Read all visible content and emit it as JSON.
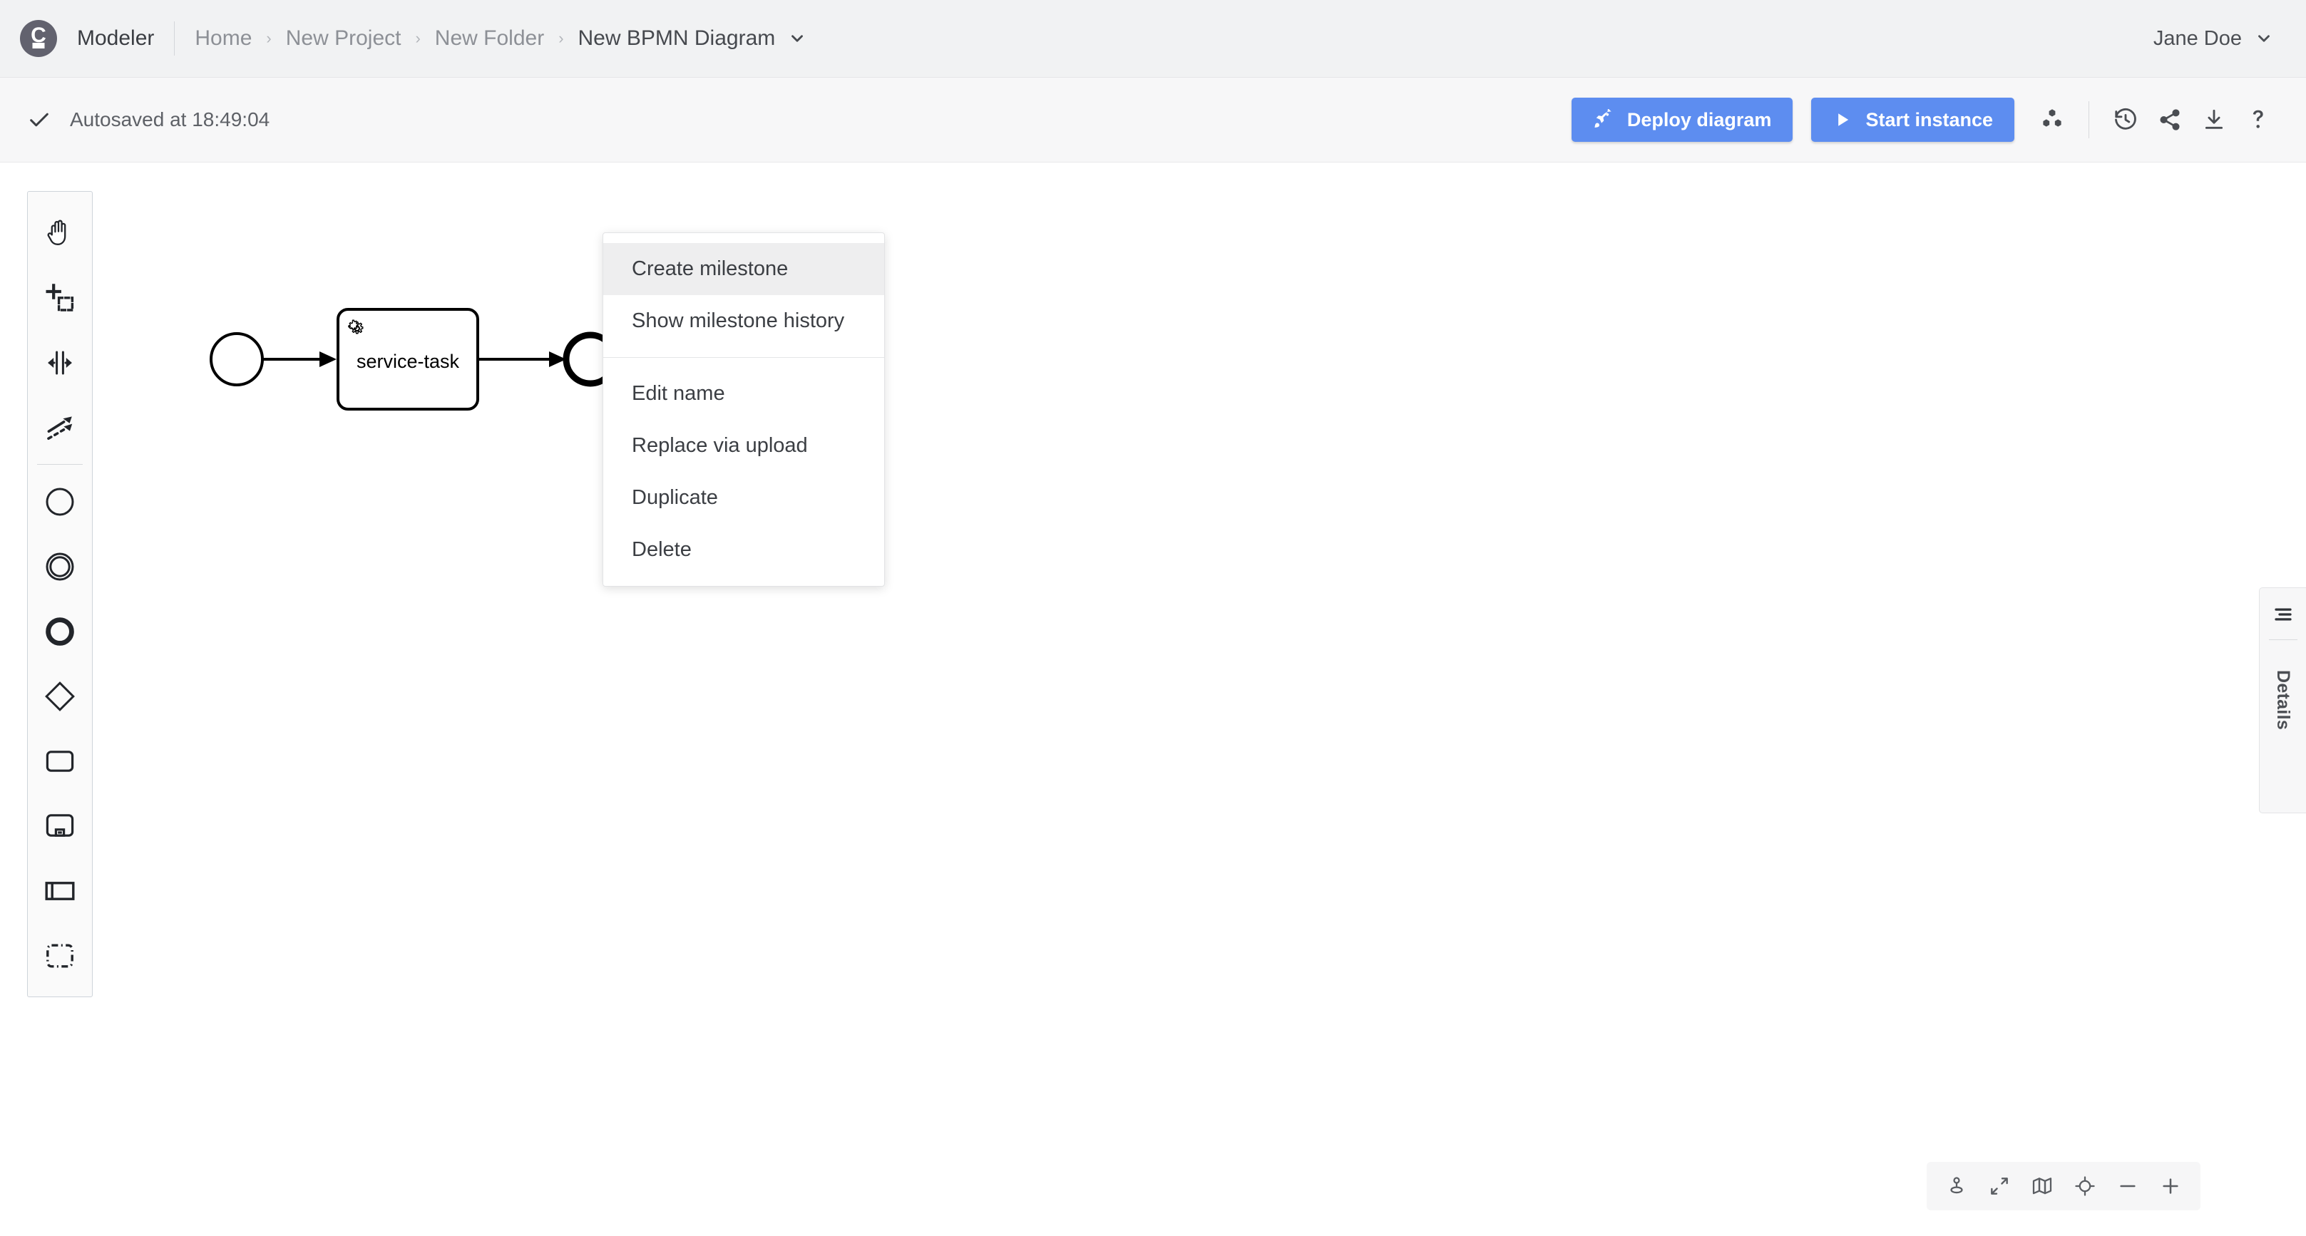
{
  "header": {
    "logo_icon": "camunda-logo-icon",
    "app_title": "Modeler",
    "breadcrumb": [
      {
        "label": "Home",
        "active": false
      },
      {
        "label": "New Project",
        "active": false
      },
      {
        "label": "New Folder",
        "active": false
      },
      {
        "label": "New BPMN Diagram",
        "active": true
      }
    ],
    "breadcrumb_separator": "›",
    "diagram_caret_icon": "chevron-down-icon",
    "user": {
      "name": "Jane Doe",
      "caret_icon": "chevron-down-icon"
    }
  },
  "toolbar": {
    "autosave_check_icon": "check-icon",
    "autosave_text": "Autosaved at 18:49:04",
    "deploy_label": "Deploy diagram",
    "deploy_icon": "rocket-icon",
    "start_label": "Start instance",
    "start_icon": "play-icon",
    "accent_color": "#5d8df0",
    "icons": [
      {
        "name": "cluster-icon"
      },
      {
        "name": "history-icon"
      },
      {
        "name": "share-icon"
      },
      {
        "name": "download-icon"
      },
      {
        "name": "help-icon"
      }
    ]
  },
  "palette": {
    "items": [
      {
        "name": "hand-tool-icon",
        "label": "Activate the hand tool"
      },
      {
        "name": "lasso-tool-icon",
        "label": "Activate the lasso tool"
      },
      {
        "name": "space-tool-icon",
        "label": "Activate the create/remove space tool"
      },
      {
        "name": "connect-tool-icon",
        "label": "Activate the global connect tool"
      },
      {
        "name": "start-event-icon",
        "label": "Create StartEvent"
      },
      {
        "name": "intermediate-event-icon",
        "label": "Create Intermediate/Boundary Event"
      },
      {
        "name": "end-event-icon",
        "label": "Create EndEvent"
      },
      {
        "name": "gateway-icon",
        "label": "Create Gateway"
      },
      {
        "name": "task-icon",
        "label": "Create Task"
      },
      {
        "name": "subprocess-icon",
        "label": "Create expanded SubProcess"
      },
      {
        "name": "pool-icon",
        "label": "Create Pool/Participant"
      },
      {
        "name": "group-icon",
        "label": "Create Group"
      }
    ]
  },
  "diagram": {
    "elements": [
      {
        "type": "start-event",
        "label": ""
      },
      {
        "type": "service-task",
        "label": "service-task",
        "marker_icon": "gear-icon"
      },
      {
        "type": "end-event",
        "label": ""
      }
    ]
  },
  "context_menu": {
    "items": [
      {
        "label": "Create milestone",
        "highlighted": true
      },
      {
        "label": "Show milestone history",
        "highlighted": false
      },
      {
        "label": "Edit name",
        "highlighted": false
      },
      {
        "label": "Replace via upload",
        "highlighted": false
      },
      {
        "label": "Duplicate",
        "highlighted": false
      },
      {
        "label": "Delete",
        "highlighted": false
      }
    ]
  },
  "details_panel": {
    "toggle_icon": "panel-menu-icon",
    "label": "Details"
  },
  "zoombar": {
    "icons": [
      {
        "name": "location-pin-icon"
      },
      {
        "name": "fit-viewport-icon"
      },
      {
        "name": "minimap-icon"
      },
      {
        "name": "reset-zoom-icon"
      },
      {
        "name": "zoom-out-icon"
      },
      {
        "name": "zoom-in-icon"
      }
    ]
  }
}
